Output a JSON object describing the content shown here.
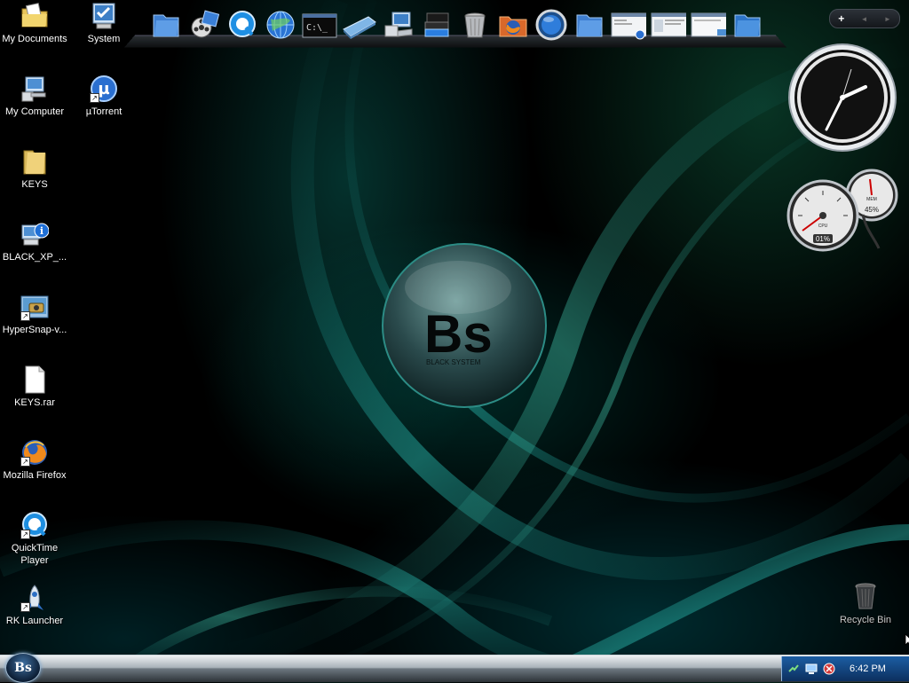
{
  "desktop_icons_left": [
    {
      "label": "My Documents",
      "icon": "documents-folder-icon"
    },
    {
      "label": "My Computer",
      "icon": "computer-icon"
    },
    {
      "label": "KEYS",
      "icon": "folder-icon"
    },
    {
      "label": "BLACK_XP_...",
      "icon": "info-computer-icon"
    },
    {
      "label": "HyperSnap-v...",
      "icon": "camera-screen-icon"
    },
    {
      "label": "KEYS.rar",
      "icon": "blank-file-icon"
    },
    {
      "label": "Mozilla Firefox",
      "icon": "firefox-icon"
    },
    {
      "label": "QuickTime Player",
      "icon": "quicktime-icon"
    },
    {
      "label": "RK Launcher",
      "icon": "rocket-icon"
    }
  ],
  "desktop_icons_col2": [
    {
      "label": "System",
      "icon": "system-icon"
    },
    {
      "label": "µTorrent",
      "icon": "utorrent-icon"
    }
  ],
  "dock": {
    "items": [
      "folder-icon",
      "film-reel-icon",
      "quicktime-icon",
      "globe-icon",
      "command-prompt-icon",
      "drive-icon",
      "computer-icon",
      "document-stack-icon",
      "trash-icon",
      "firefox-folder-icon",
      "blue-circle-icon",
      "folder-icon",
      "window-preview-icon",
      "window-preview-icon",
      "window-preview-icon",
      "folder-icon"
    ],
    "command_prompt_text": "C:\\_"
  },
  "topbar": {
    "add": "+",
    "prev": "◄",
    "next": "►"
  },
  "gauges": {
    "cpu_label": "CPU",
    "cpu_value": "01%",
    "mem_label": "MEM",
    "mem_value": "45%"
  },
  "logo": {
    "text": "Bs",
    "subtext": "BLACK SYSTEM"
  },
  "recycle_bin": {
    "label": "Recycle Bin"
  },
  "taskbar": {
    "start_label": "Bs",
    "time": "6:42 PM"
  }
}
